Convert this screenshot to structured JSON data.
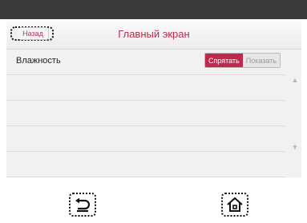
{
  "header": {
    "back_label": "Назад",
    "title": "Главный экран"
  },
  "rows": [
    {
      "label": "Влажность",
      "toggle": {
        "on_label": "Спрятать",
        "off_label": "Показать"
      }
    }
  ],
  "icons": {
    "scroll_up": "chevron-up-icon",
    "scroll_down": "chevron-down-icon",
    "back": "back-arrow-icon",
    "home": "home-icon"
  },
  "colors": {
    "accent": "#c0284f",
    "topbar": "#3a3a3a",
    "panel": "#f1f1f1"
  }
}
